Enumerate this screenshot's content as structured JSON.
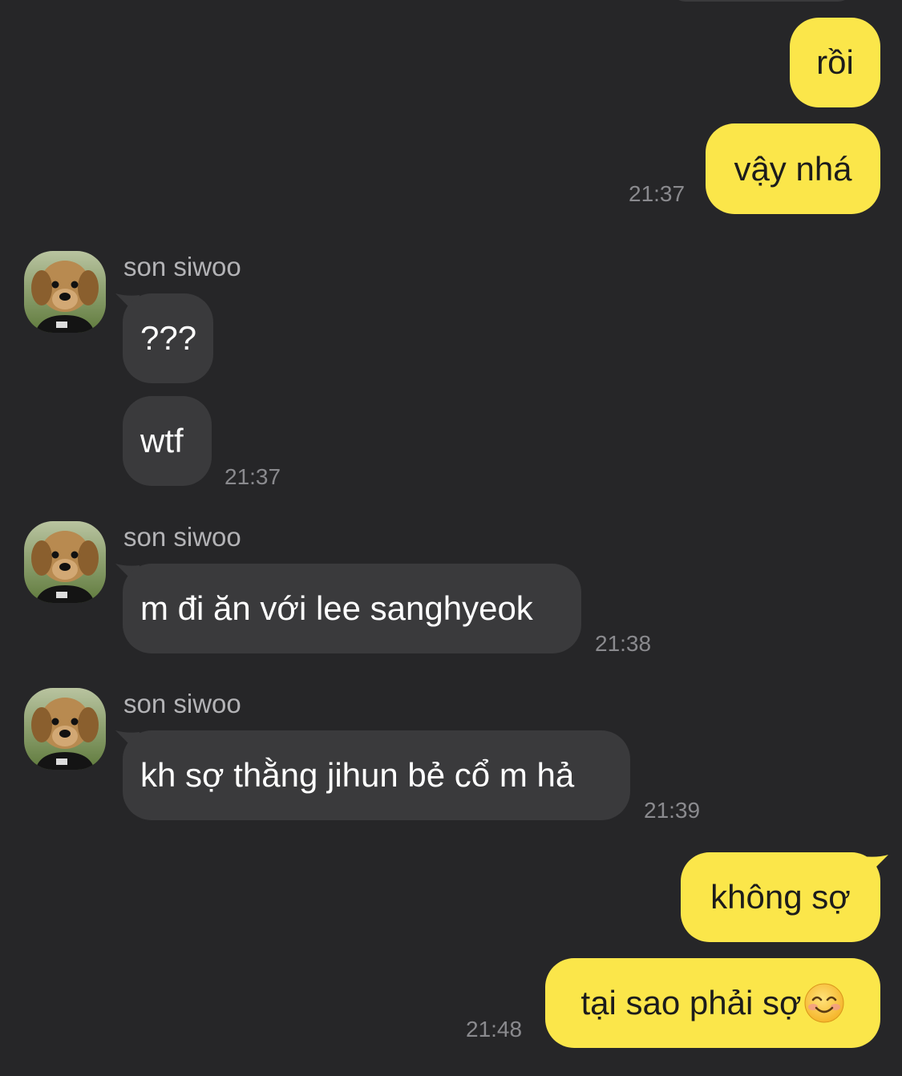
{
  "colors": {
    "background": "#262628",
    "my_bubble": "#fbe64a",
    "their_bubble": "#3a3a3c",
    "timestamp": "#8a8a8e",
    "sender_name": "#b3b3b6"
  },
  "messages": {
    "m1": {
      "text": "rồi"
    },
    "m2": {
      "text": "vậy nhá",
      "time": "21:37"
    },
    "g1": {
      "sender": "son siwoo",
      "m1": {
        "text": "???"
      },
      "m2": {
        "text": "wtf",
        "time": "21:37"
      }
    },
    "g2": {
      "sender": "son siwoo",
      "m1": {
        "text": "m đi ăn với lee sanghyeok",
        "time": "21:38"
      }
    },
    "g3": {
      "sender": "son siwoo",
      "m1": {
        "text": "kh sợ thằng jihun bẻ cổ m hả",
        "time": "21:39"
      }
    },
    "m3": {
      "text": "không sợ"
    },
    "m4": {
      "text": "tại sao phải sợ",
      "emoji_icon": "smiling-face-emoji-icon",
      "time": "21:48"
    }
  }
}
